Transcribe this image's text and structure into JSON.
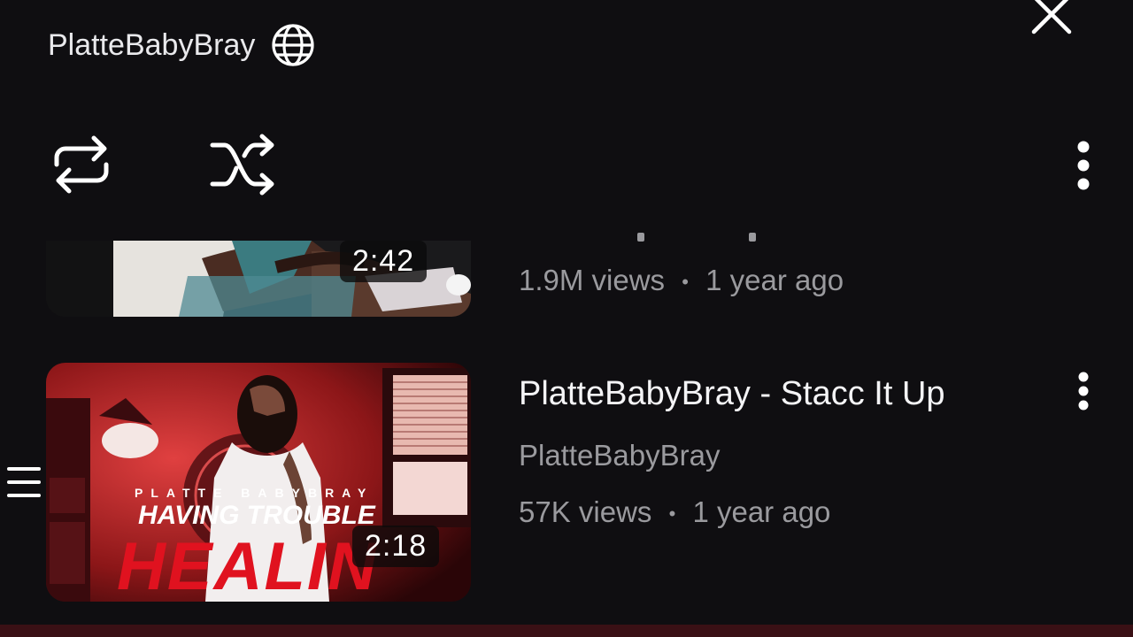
{
  "playlist": {
    "channel": "PlatteBabyBray",
    "visibility_icon": "globe-icon",
    "close_icon": "close-icon"
  },
  "controls": {
    "loop_icon": "loop-icon",
    "shuffle_icon": "shuffle-icon",
    "menu_icon": "more-vertical-icon"
  },
  "videos": [
    {
      "duration": "2:42",
      "views": "1.9M views",
      "age": "1 year ago",
      "separator": "•"
    },
    {
      "title": "PlatteBabyBray - Stacc It Up",
      "channel": "PlatteBabyBray",
      "duration": "2:18",
      "views": "57K views",
      "age": "1 year ago",
      "separator": "•",
      "thumbnail": {
        "top_text": "PLATTE BABYBRAY",
        "middle_text": "HAVING TROUBLE",
        "bottom_text": "HEALIN"
      }
    }
  ],
  "colors": {
    "background": "#0f0e11",
    "accent_red": "#c8182a",
    "meta_grey": "#9a9a9e",
    "bottom_bar": "#3a1015"
  }
}
